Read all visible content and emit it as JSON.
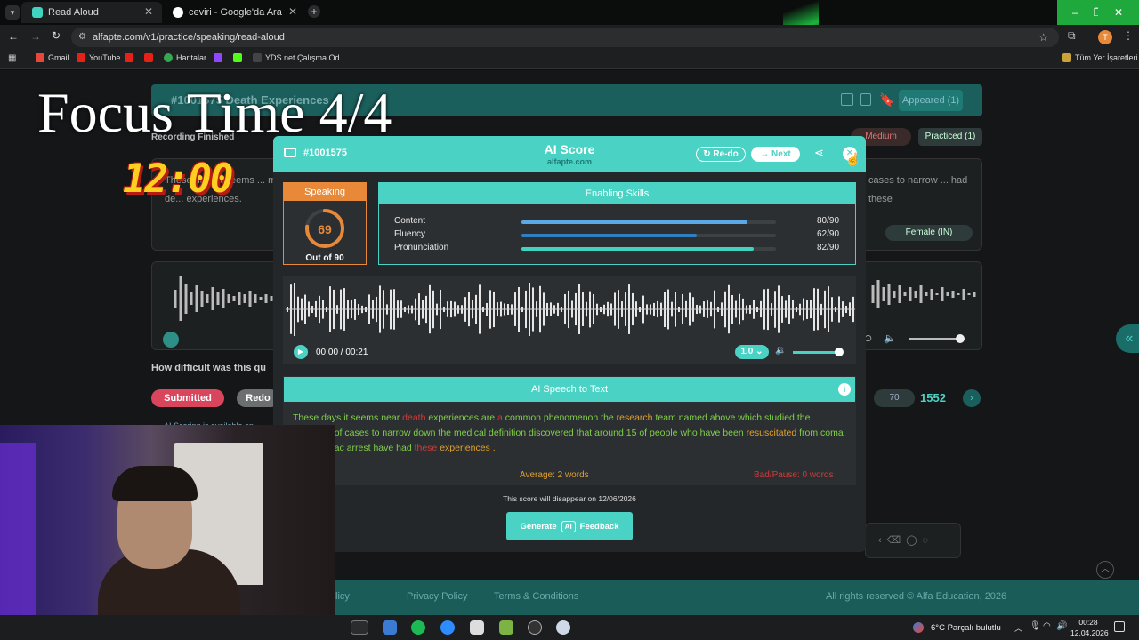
{
  "browser": {
    "tabs": [
      {
        "label": "Read Aloud",
        "active": true
      },
      {
        "label": "ceviri - Google'da Ara",
        "active": false
      }
    ],
    "url": "alfapte.com/v1/practice/speaking/read-aloud",
    "bookmarks": [
      "Gmail",
      "YouTube",
      "Haritalar",
      "YDS.net Çalışma Od..."
    ],
    "bookmarks_right": "Tüm Yer İşaretleri",
    "profile_initial": "T"
  },
  "overlay": {
    "focus_text": "Focus Time 4/4",
    "timer": "12:00"
  },
  "page": {
    "question_title": "#1001575 Death Experiences",
    "recording_status": "Recording Finished",
    "badge_medium": "Medium",
    "badge_practiced": "Practiced (1)",
    "badge_appeared": "Appeared (1)",
    "passage_left": "These days it seems ... medical de... experiences.",
    "passage_right": "cases to narrow ... had these",
    "voice_select": "Female (IN)",
    "difficulty_question": "How difficult was this qu",
    "submitted_label": "Submitted",
    "redo_label": "Redo",
    "ai_scoring_note": "AI Scoring is available on...",
    "page_select": "70",
    "total_count": "1552",
    "footer_links": [
      "Cancellation Policy",
      "Privacy Policy",
      "Terms & Conditions"
    ],
    "copyright": "All rights reserved © Alfa Education, 2026"
  },
  "modal": {
    "question_id": "#1001575",
    "title": "AI Score",
    "subtitle": "alfapte.com",
    "redo_button": "Re-do",
    "next_button": "Next",
    "speaking_label": "Speaking",
    "score": "69",
    "score_caption": "Out of 90",
    "score_fraction": 0.767,
    "enabling_skills_title": "Enabling Skills",
    "skills": [
      {
        "name": "Content",
        "value": "80/90",
        "fraction": 0.889,
        "color": "#5aa9e6"
      },
      {
        "name": "Fluency",
        "value": "62/90",
        "fraction": 0.689,
        "color": "#2f7fc1"
      },
      {
        "name": "Pronunciation",
        "value": "82/90",
        "fraction": 0.911,
        "color": "#3fd3c0"
      }
    ],
    "player": {
      "time": "00:00 / 00:21",
      "speed": "1.0",
      "volume_fraction": 1.0
    },
    "speech_to_text_title": "AI Speech to Text",
    "transcript_segments": [
      {
        "text": "These days it seems near ",
        "color": "#7fcf4a"
      },
      {
        "text": "death ",
        "color": "#d23a3a"
      },
      {
        "text": "experiences are ",
        "color": "#7fcf4a"
      },
      {
        "text": "a ",
        "color": "#d23a3a"
      },
      {
        "text": "common phenomenon the ",
        "color": "#7fcf4a"
      },
      {
        "text": "research ",
        "color": "#e0a030"
      },
      {
        "text": "team named above which studied ",
        "color": "#7fcf4a"
      },
      {
        "text": "the hundreds of cases to narrow down the medical definition discovered that around 15 of people who have been ",
        "color": "#7fcf4a"
      },
      {
        "text": "resuscitated ",
        "color": "#e0a030"
      },
      {
        "text": "from coma after cardiac arrest have had ",
        "color": "#7fcf4a"
      },
      {
        "text": "these ",
        "color": "#d23a3a"
      },
      {
        "text": "experiences .",
        "color": "#e0a030"
      }
    ],
    "stats_left": "words",
    "stats_middle": "Average: 2 words",
    "stats_right": "Bad/Pause: 0 words",
    "disappear_note": "This score will disappear on 12/06/2026",
    "generate_button_pre": "Generate",
    "generate_button_ai": "AI",
    "generate_button_post": "Feedback"
  },
  "taskbar": {
    "weather": "6°C  Parçalı bulutlu",
    "time": "00:28",
    "date": "12.04.2026"
  },
  "colors": {
    "accent": "#4ad2c4",
    "speaking": "#e8893a",
    "submitted": "#d9455c"
  }
}
